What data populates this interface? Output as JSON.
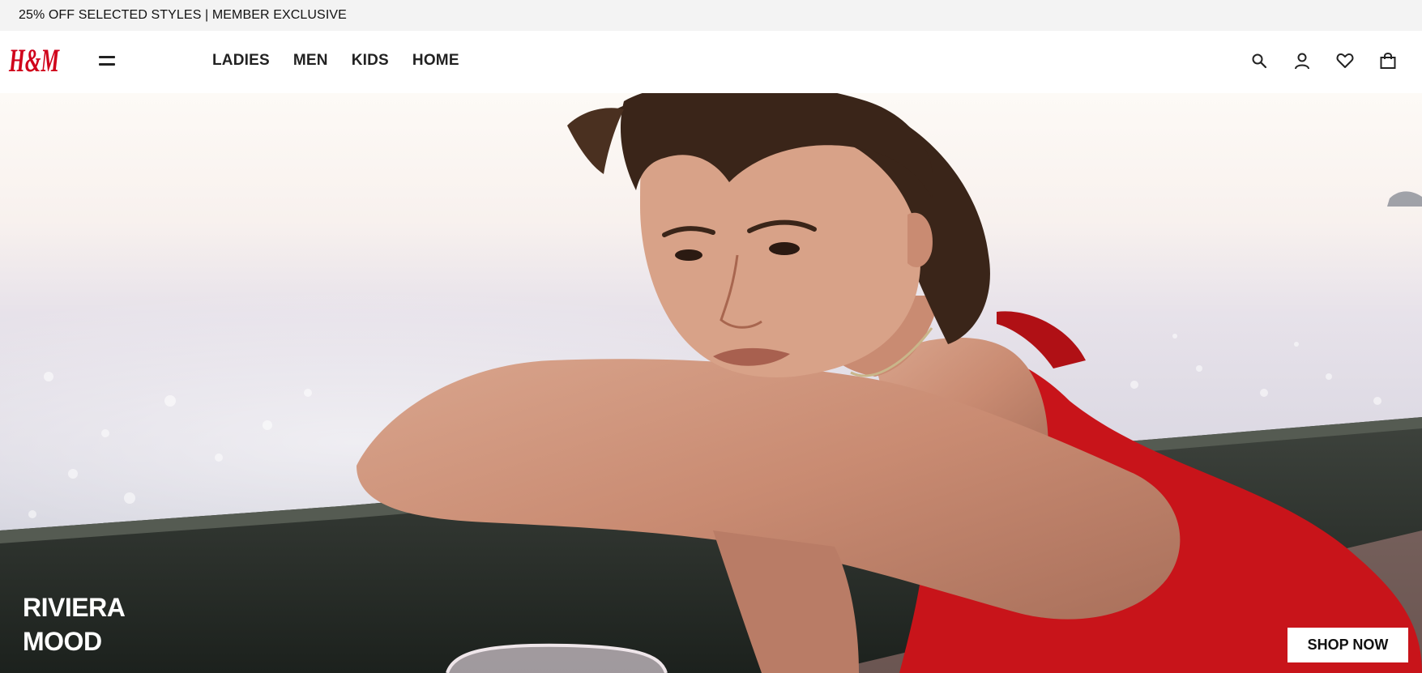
{
  "promo": {
    "text": "25% OFF SELECTED STYLES | MEMBER EXCLUSIVE"
  },
  "header": {
    "logo_text": "H&M",
    "menu_icon": "hamburger-menu-icon",
    "nav": [
      {
        "label": "LADIES"
      },
      {
        "label": "MEN"
      },
      {
        "label": "KIDS"
      },
      {
        "label": "HOME"
      }
    ],
    "icons": [
      "search-icon",
      "account-icon",
      "favorites-heart-icon",
      "shopping-bag-icon"
    ]
  },
  "hero": {
    "title_line1": "RIVIERA",
    "title_line2": "MOOD",
    "cta_label": "SHOP NOW"
  },
  "colors": {
    "brand_red": "#d0021b",
    "promo_bg": "#f3f3f3",
    "text_dark": "#222222",
    "swimsuit_red": "#c8141a"
  }
}
